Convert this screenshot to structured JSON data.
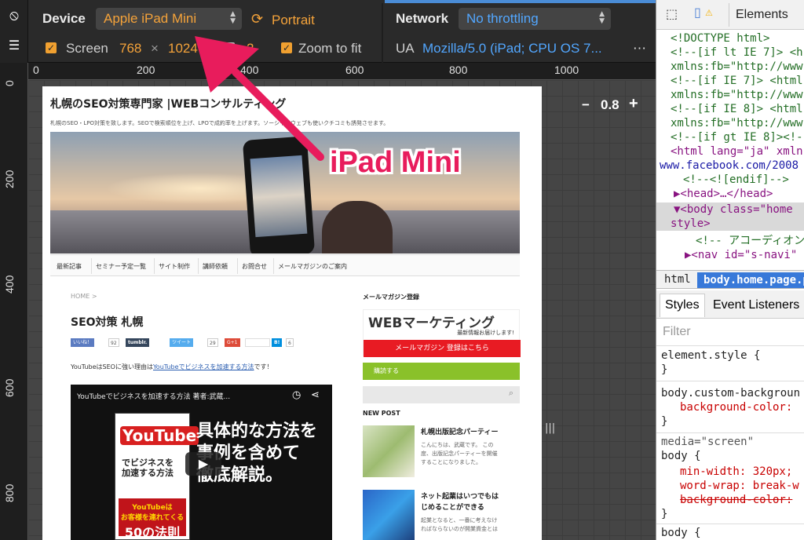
{
  "toolbar": {
    "device_label": "Device",
    "device_value": "Apple iPad Mini",
    "orientation": "Portrait",
    "network_label": "Network",
    "network_value": "No throttling",
    "screen_label": "Screen",
    "screen_width": "768",
    "screen_x": "×",
    "screen_height": "1024",
    "dpr_value": "2",
    "zoom_label": "Zoom to fit",
    "ua_label": "UA",
    "ua_value": "Mozilla/5.0 (iPad; CPU OS 7...",
    "more": "⋯"
  },
  "ruler": {
    "top": [
      "0",
      "200",
      "400",
      "600",
      "800",
      "1000"
    ],
    "left": [
      "0",
      "200",
      "400",
      "600",
      "800"
    ]
  },
  "zoom": {
    "minus": "−",
    "value": "0.8",
    "plus": "+"
  },
  "annotation": {
    "label": "iPad Mini"
  },
  "site": {
    "title": "札幌のSEO対策専門家 |WEBコンサルティング",
    "description": "札幌のSEO・LPO対策を致します。SEOで検索順位を上げ、LPOで成約率を上げます。ソーシャルウェブも使いクチコミも誘発させます。",
    "nav": [
      "最新記事",
      "セミナー予定一覧",
      "サイト制作",
      "講師依頼",
      "お問合せ",
      "メールマガジンのご案内"
    ],
    "breadcrumb": "HOME >",
    "post_title": "SEO対策 札幌",
    "share": {
      "like": "いいね！",
      "like_count": "92",
      "tumblr": "tumblr.",
      "tweet": "ツイート",
      "tweet_count": "29",
      "gplus": "G+1",
      "hatena": "B!",
      "hatena_count": "6"
    },
    "intro_prefix": "YouTubeはSEOに強い理由は",
    "intro_link": "YouTubeでビジネスを加速する方法",
    "intro_suffix": "です！",
    "video": {
      "title": "YouTubeでビジネスを加速する方法 著者:武蔵...",
      "book_brand": "YouTube",
      "book_sub": "でビジネスを\n加速する方法",
      "book_red_top": "YouTubeは\nお客様を連れてくる",
      "book_red_big": "50の法則",
      "big_text": "具体的な方法を\n事例を含めて\n徹底解説。",
      "play": "▶"
    },
    "sidebar": {
      "mm_heading": "メールマガジン登録",
      "mm_banner": "WEBマーケティング",
      "mm_sub": "最新情報お届けします!",
      "mm_button": "メールマガジン 登録はこちら",
      "subscribe": "購読する",
      "new_post": "NEW POST",
      "posts": [
        {
          "title": "札幌出版記念パーティー",
          "text": "こんにちは、武蔵です。 この\n度、出版記念パーティーを開催\nすることになりました。"
        },
        {
          "title": "ネット起業はいつでもは\nじめることができる",
          "text": "起業となると、一番に考えなけ\nればならないのが開業資金とは"
        }
      ]
    }
  },
  "devtools": {
    "tab_elements": "Elements",
    "dom": [
      "<!DOCTYPE html>",
      "<!--[if lt IE 7]> <h",
      "xmlns:fb=\"http://www",
      "<!--[if IE 7]> <html",
      "xmlns:fb=\"http://www",
      "<!--[if IE 8]> <html",
      "xmlns:fb=\"http://www",
      "<!--[if gt IE 8]><!-",
      "<html lang=\"ja\" xmln",
      "www.facebook.com/2008",
      "<!--<![endif]-->",
      "▶<head>…</head>",
      "▼<body class=\"home",
      "style>",
      "<!-- アコーディオン",
      "▶<nav id=\"s-navi\""
    ],
    "crumb_html": "html",
    "crumb_body": "body.home.page.p",
    "styles_tab": "Styles",
    "events_tab": "Event Listeners",
    "filter": "Filter",
    "css": [
      "element.style {",
      "}",
      "body.custom-backgroun",
      "background-color:",
      "}",
      "media=\"screen\"",
      "body {",
      "min-width: 320px;",
      "word-wrap: break-w",
      "background-color: ",
      "}",
      "body {"
    ]
  },
  "colors": {
    "accent_orange": "#f5a33a",
    "accent_blue": "#52a7ff",
    "annotation": "#e81c5c"
  }
}
